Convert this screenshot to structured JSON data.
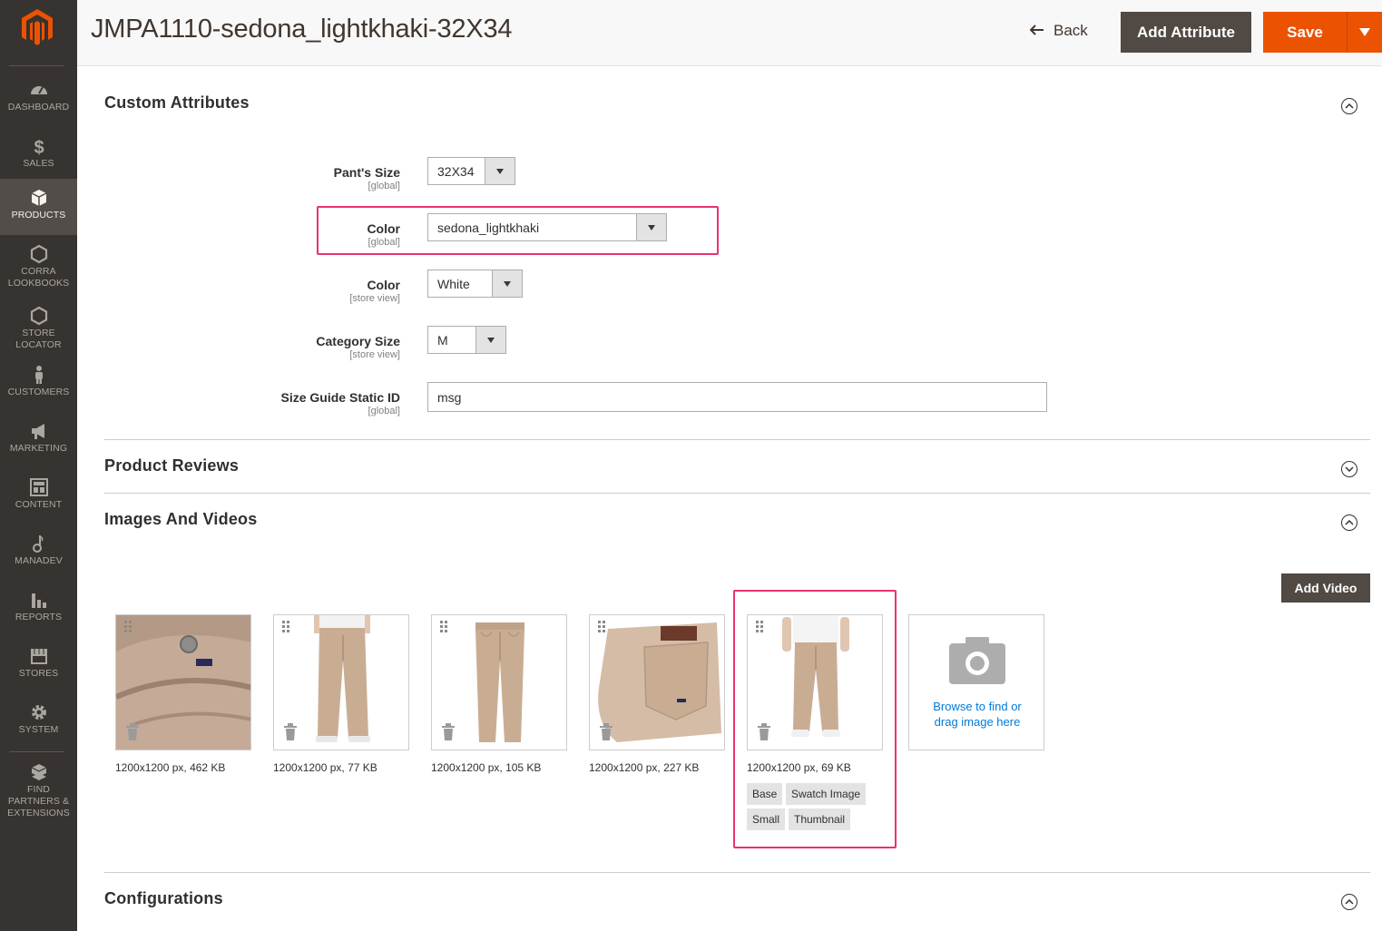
{
  "header": {
    "title": "JMPA1110-sedona_lightkhaki-32X34",
    "back_label": "Back",
    "add_attribute_label": "Add Attribute",
    "save_label": "Save"
  },
  "sidebar": {
    "items": [
      {
        "label": "DASHBOARD",
        "icon": "dashboard-icon"
      },
      {
        "label": "SALES",
        "icon": "dollar-icon"
      },
      {
        "label": "PRODUCTS",
        "icon": "box-icon",
        "active": true
      },
      {
        "label": "CORRA LOOKBOOKS",
        "icon": "hexagon-icon"
      },
      {
        "label": "STORE LOCATOR",
        "icon": "hexagon-icon"
      },
      {
        "label": "CUSTOMERS",
        "icon": "person-icon"
      },
      {
        "label": "MARKETING",
        "icon": "megaphone-icon"
      },
      {
        "label": "CONTENT",
        "icon": "layout-icon"
      },
      {
        "label": "MANADEV",
        "icon": "bell-icon"
      },
      {
        "label": "REPORTS",
        "icon": "bar-chart-icon"
      },
      {
        "label": "STORES",
        "icon": "storefront-icon"
      },
      {
        "label": "SYSTEM",
        "icon": "gear-icon"
      },
      {
        "label": "FIND PARTNERS & EXTENSIONS",
        "icon": "cubes-icon"
      }
    ]
  },
  "custom_attributes": {
    "title": "Custom Attributes",
    "fields": [
      {
        "label": "Pant's Size",
        "scope": "[global]",
        "value": "32X34"
      },
      {
        "label": "Color",
        "scope": "[global]",
        "value": "sedona_lightkhaki"
      },
      {
        "label": "Color",
        "scope": "[store view]",
        "value": "White"
      },
      {
        "label": "Category Size",
        "scope": "[store view]",
        "value": "M"
      },
      {
        "label": "Size Guide Static ID",
        "scope": "[global]",
        "value": "msg"
      }
    ]
  },
  "product_reviews": {
    "title": "Product Reviews"
  },
  "images_videos": {
    "title": "Images And Videos",
    "add_video_label": "Add Video",
    "images": [
      {
        "meta": "1200x1200 px, 462 KB"
      },
      {
        "meta": "1200x1200 px, 77 KB"
      },
      {
        "meta": "1200x1200 px, 105 KB"
      },
      {
        "meta": "1200x1200 px, 227 KB"
      },
      {
        "meta": "1200x1200 px, 69 KB",
        "roles": [
          "Base",
          "Swatch Image",
          "Small",
          "Thumbnail"
        ]
      }
    ],
    "upload_label_line1": "Browse to find or",
    "upload_label_line2": "drag image here"
  },
  "configurations": {
    "title": "Configurations"
  },
  "colors": {
    "sidebar_bg": "#373330",
    "accent_orange": "#eb5202",
    "dark_button": "#514943",
    "highlight_pink": "#e8336e",
    "link_blue": "#007bdb",
    "khaki": "#c9ad93"
  }
}
